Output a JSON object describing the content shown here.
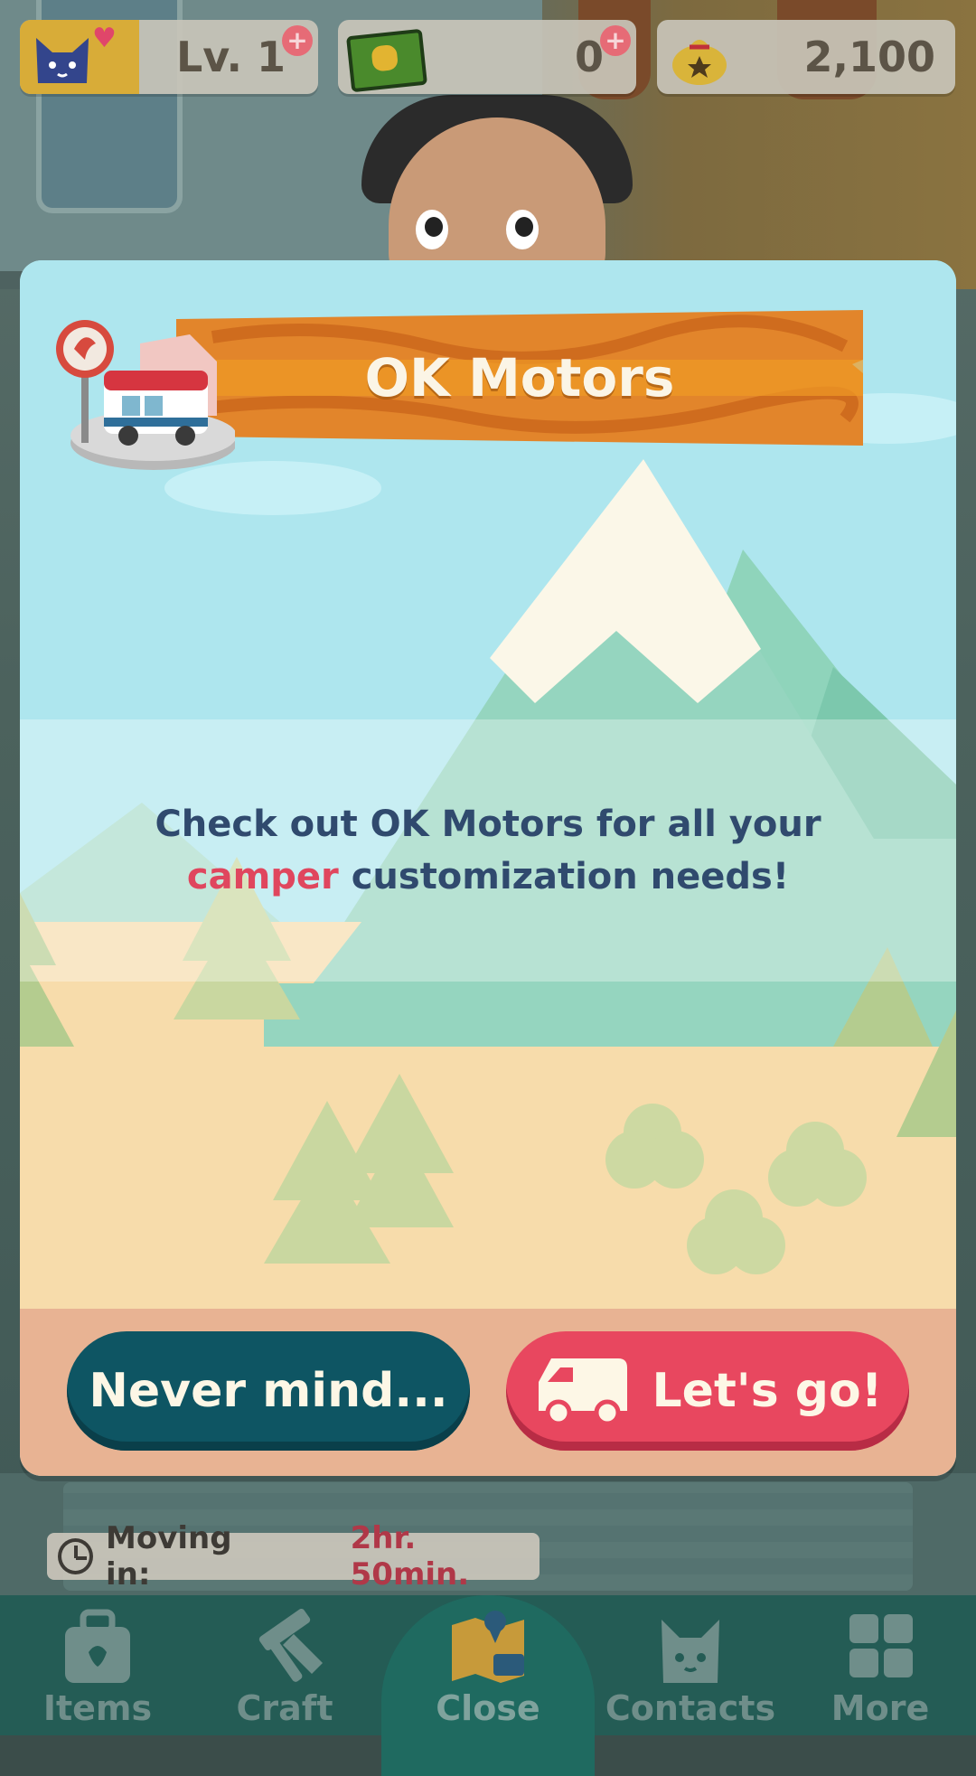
{
  "hud": {
    "level": "Lv. 1",
    "tickets": "0",
    "bells": "2,100",
    "icons": [
      "cat-avatar-icon",
      "heart-icon",
      "plus-icon",
      "leaf-ticket-icon",
      "bell-bag-icon"
    ],
    "plus_symbol": "+"
  },
  "modal": {
    "title": "OK Motors",
    "message_part1": "Check out OK Motors for all your",
    "message_highlight": "camper",
    "message_part2": " customization needs!",
    "cancel_label": "Never mind...",
    "go_label": "Let's go!",
    "colors": {
      "sky": "#aee6ee",
      "banner_orange": "#e2852b",
      "cancel_button": "#0e5563",
      "go_button": "#e8475f",
      "highlight_text": "#e0465e",
      "body_text": "#304a6e"
    }
  },
  "moving": {
    "label": "Moving in:",
    "time": "2hr. 50min."
  },
  "nav": {
    "items": [
      {
        "label": "Items",
        "icon": "bag-icon"
      },
      {
        "label": "Craft",
        "icon": "hammer-saw-icon"
      },
      {
        "label": "Close",
        "icon": "map-icon"
      },
      {
        "label": "Contacts",
        "icon": "cat-face-icon"
      },
      {
        "label": "More",
        "icon": "grid-icon"
      }
    ]
  }
}
